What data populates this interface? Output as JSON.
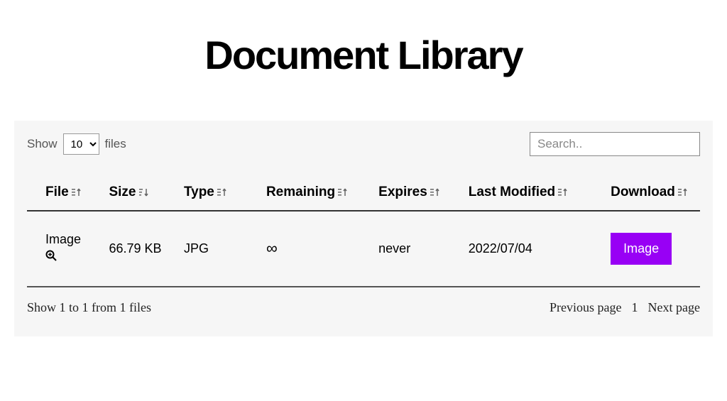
{
  "title": "Document Library",
  "controls": {
    "show_label": "Show",
    "files_label": "files",
    "per_page": "10",
    "search_placeholder": "Search.."
  },
  "columns": {
    "file": "File",
    "size": "Size",
    "type": "Type",
    "remaining": "Remaining",
    "expires": "Expires",
    "last_modified": "Last Modified",
    "download": "Download"
  },
  "rows": [
    {
      "file": "Image",
      "size": "66.79 KB",
      "type": "JPG",
      "remaining": "∞",
      "expires": "never",
      "last_modified": "2022/07/04",
      "download_label": "Image"
    }
  ],
  "footer": {
    "summary": "Show 1 to 1 from 1 files",
    "prev": "Previous page",
    "page": "1",
    "next": "Next page"
  }
}
